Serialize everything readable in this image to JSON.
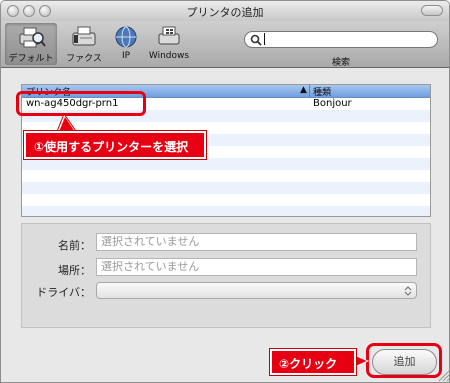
{
  "window": {
    "title": "プリンタの追加"
  },
  "toolbar": {
    "items": [
      {
        "label": "デフォルト",
        "icon": "default-printer-icon"
      },
      {
        "label": "ファクス",
        "icon": "fax-icon"
      },
      {
        "label": "IP",
        "icon": "globe-icon"
      },
      {
        "label": "Windows",
        "icon": "windows-printer-icon"
      }
    ],
    "search_label": "検索",
    "search_value": ""
  },
  "list": {
    "columns": [
      "プリンタ名",
      "種類"
    ],
    "sort_arrow": "▲",
    "rows": [
      {
        "name": "wn-ag450dgr-prn1",
        "kind": "Bonjour"
      }
    ]
  },
  "form": {
    "name_label": "名前：",
    "name_value": "選択されていません",
    "location_label": "場所：",
    "location_value": "選択されていません",
    "driver_label": "ドライバ：",
    "driver_value": ""
  },
  "buttons": {
    "add": "追加"
  },
  "annotations": {
    "step1": "①使用するプリンターを選択",
    "step2": "②クリック"
  },
  "colors": {
    "accent": "#e60012",
    "list_header": "#8fb5ea",
    "alt_row": "#eaf1fb"
  }
}
